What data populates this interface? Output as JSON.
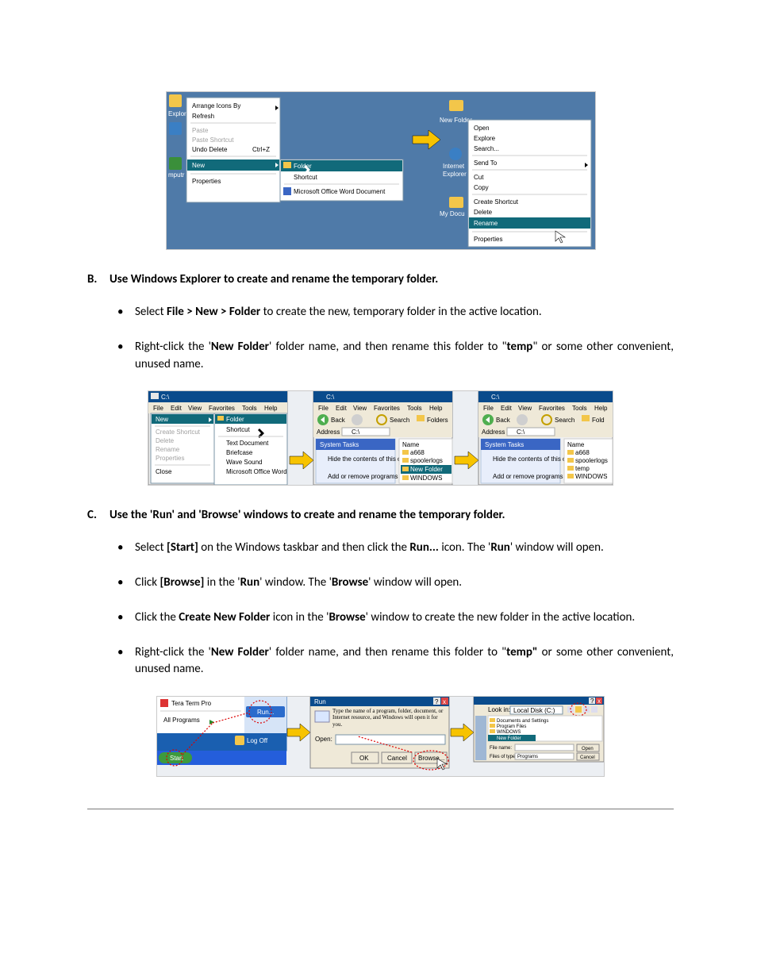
{
  "sectionB": {
    "letter": "B.",
    "heading": "Use Windows Explorer to create and rename the temporary folder.",
    "step1_prefix": "Select ",
    "step1_bold": "File > New > Folder",
    "step1_suffix": " to create the new, temporary folder in the active location.",
    "step2_a": "Right-click the '",
    "step2_b": "New Folder",
    "step2_c": "' folder name, and then rename this folder to \"",
    "step2_d": "temp",
    "step2_e": "\" or some other convenient, unused name."
  },
  "sectionC": {
    "letter": "C.",
    "heading": "Use the 'Run' and 'Browse' windows to create and rename the temporary folder.",
    "step1_a": "Select ",
    "step1_b": "[Start]",
    "step1_c": " on the Windows taskbar and then click the ",
    "step1_d": "Run...",
    "step1_e": " icon. The '",
    "step1_f": "Run",
    "step1_g": "' window will open.",
    "step2_a": "Click ",
    "step2_b": "[Browse]",
    "step2_c": " in the '",
    "step2_d": "Run",
    "step2_e": "' window. The '",
    "step2_f": "Browse",
    "step2_g": "' window will open.",
    "step3_a": "Click the ",
    "step3_b": "Create New Folder",
    "step3_c": " icon in the '",
    "step3_d": "Browse",
    "step3_e": "' window to create the new folder in the active location.",
    "step4_a": "Right-click the '",
    "step4_b": "New Folder",
    "step4_c": "' folder name, and then rename this folder to \"",
    "step4_d": "temp\"",
    "step4_e": " or some other convenient, unused name."
  },
  "fig1": {
    "desktop_menu": {
      "arrange": "Arrange Icons By",
      "refresh": "Refresh",
      "paste": "Paste",
      "paste_shortcut": "Paste Shortcut",
      "undo_delete": "Undo Delete",
      "undo_key": "Ctrl+Z",
      "new": "New",
      "properties": "Properties",
      "sub_folder": "Folder",
      "sub_shortcut": "Shortcut",
      "sub_word": "Microsoft Office Word Document"
    },
    "desktop_icons": {
      "new_folder": "New Folder",
      "internet": "Internet",
      "explorer": "Explorer",
      "my_docs": "My Docu"
    },
    "folder_menu": {
      "open": "Open",
      "explore": "Explore",
      "search": "Search...",
      "send_to": "Send To",
      "cut": "Cut",
      "copy": "Copy",
      "create_shortcut": "Create Shortcut",
      "delete": "Delete",
      "rename": "Rename",
      "properties": "Properties"
    }
  },
  "fig2": {
    "titlebar": "C:\\",
    "menus": [
      "File",
      "Edit",
      "View",
      "Favorites",
      "Tools",
      "Help"
    ],
    "file_menu": {
      "new": "New",
      "create_shortcut": "Create Shortcut",
      "delete": "Delete",
      "rename": "Rename",
      "properties": "Properties",
      "close": "Close",
      "sub_folder": "Folder",
      "sub_shortcut": "Shortcut",
      "sub_textdoc": "Text Document",
      "sub_briefcase": "Briefcase",
      "sub_wave": "Wave Sound",
      "sub_word": "Microsoft Office Word"
    },
    "toolbar": {
      "back": "Back",
      "search": "Search",
      "folders": "Folders",
      "address": "Address",
      "address_value": "C:\\"
    },
    "sidebar": {
      "system_tasks": "System Tasks",
      "hide": "Hide the contents of this drive",
      "addremove": "Add or remove programs"
    },
    "files": {
      "name": "Name",
      "a668": "a668",
      "spoolerlogs": "spoolerlogs",
      "new_folder": "New Folder",
      "temp": "temp",
      "windows": "WINDOWS"
    }
  },
  "fig3": {
    "start_menu": {
      "tera": "Tera Term Pro",
      "all_programs": "All Programs",
      "run": "Run...",
      "logoff": "Log Off",
      "start": "Start"
    },
    "run_dialog": {
      "title": "Run",
      "desc": "Type the name of a program, folder, document, or Internet resource, and Windows will open it for you.",
      "open_label": "Open:",
      "ok": "OK",
      "cancel": "Cancel",
      "browse": "Browse..."
    },
    "browse_dialog": {
      "lookin": "Look in:",
      "lookin_value": "Local Disk (C:)",
      "docs": "Documents and Settings",
      "progfiles": "Program Files",
      "windows": "WINDOWS",
      "newfolder": "New Folder",
      "filename": "File name:",
      "filetype": "Files of type:",
      "filetype_value": "Programs",
      "open": "Open",
      "cancel": "Cancel"
    }
  }
}
